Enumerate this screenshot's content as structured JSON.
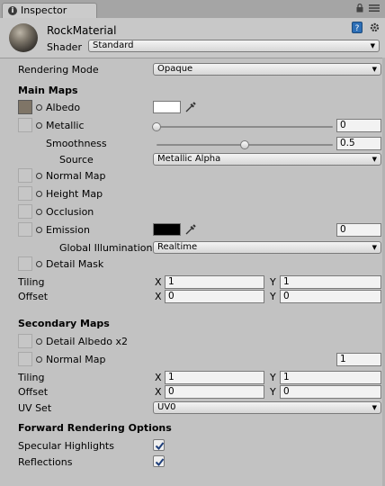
{
  "tab": {
    "title": "Inspector",
    "icon": "info-icon"
  },
  "header": {
    "material_name": "RockMaterial",
    "shader_label": "Shader",
    "shader_value": "Standard"
  },
  "rendering_mode": {
    "label": "Rendering Mode",
    "value": "Opaque"
  },
  "main_maps": {
    "title": "Main Maps",
    "albedo": {
      "label": "Albedo",
      "color": "#ffffff"
    },
    "metallic": {
      "label": "Metallic",
      "value": "0",
      "slider_level": 0.0
    },
    "smoothness": {
      "label": "Smoothness",
      "value": "0.5",
      "slider_level": 0.5
    },
    "source": {
      "label": "Source",
      "value": "Metallic Alpha"
    },
    "normal_map": {
      "label": "Normal Map"
    },
    "height_map": {
      "label": "Height Map"
    },
    "occlusion": {
      "label": "Occlusion"
    },
    "emission": {
      "label": "Emission",
      "value": "0",
      "color": "#000000"
    },
    "global_illumination": {
      "label": "Global Illumination",
      "value": "Realtime"
    },
    "detail_mask": {
      "label": "Detail Mask"
    },
    "tiling": {
      "label": "Tiling",
      "x": "1",
      "y": "1"
    },
    "offset": {
      "label": "Offset",
      "x": "0",
      "y": "0"
    }
  },
  "secondary_maps": {
    "title": "Secondary Maps",
    "detail_albedo": {
      "label": "Detail Albedo x2"
    },
    "normal_map": {
      "label": "Normal Map",
      "value": "1"
    },
    "tiling": {
      "label": "Tiling",
      "x": "1",
      "y": "1"
    },
    "offset": {
      "label": "Offset",
      "x": "0",
      "y": "0"
    },
    "uv_set": {
      "label": "UV Set",
      "value": "UV0"
    }
  },
  "forward_rendering": {
    "title": "Forward Rendering Options",
    "specular_highlights": {
      "label": "Specular Highlights",
      "checked": true
    },
    "reflections": {
      "label": "Reflections",
      "checked": true
    }
  },
  "axis_labels": {
    "x": "X",
    "y": "Y"
  }
}
